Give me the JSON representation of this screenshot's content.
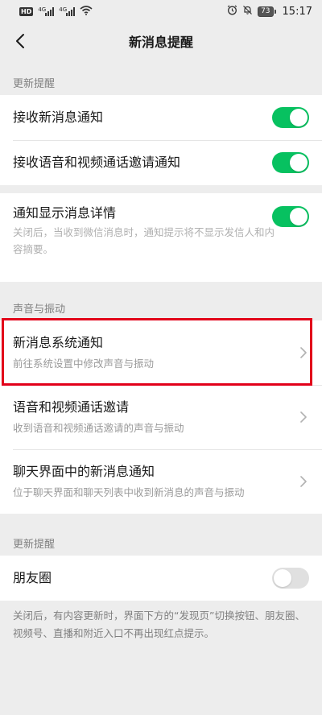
{
  "status_bar": {
    "hd_badge": "HD",
    "sim1_label": "4G",
    "sim2_label": "4G",
    "battery": "73",
    "time": "15:17"
  },
  "nav": {
    "title": "新消息提醒"
  },
  "sections": {
    "update_reminder_header": "更新提醒",
    "sound_vibration_header": "声音与振动",
    "update_reminder_header_2": "更新提醒"
  },
  "notifications": {
    "receive_new": {
      "label": "接收新消息通知",
      "enabled": true
    },
    "receive_call": {
      "label": "接收语音和视频通话邀请通知",
      "enabled": true
    },
    "show_details": {
      "label": "通知显示消息详情",
      "enabled": true,
      "description": "关闭后，当收到微信消息时，通知提示将不显示发信人和内容摘要。"
    }
  },
  "sound": {
    "system_notify": {
      "label": "新消息系统通知",
      "sub": "前往系统设置中修改声音与振动"
    },
    "call_invite": {
      "label": "语音和视频通话邀请",
      "sub": "收到语音和视频通话邀请的声音与振动"
    },
    "chat_notify": {
      "label": "聊天界面中的新消息通知",
      "sub": "位于聊天界面和聊天列表中收到新消息的声音与振动"
    }
  },
  "moments": {
    "label": "朋友圈",
    "enabled": false,
    "note": "关闭后，有内容更新时，界面下方的“发现页”切换按钮、朋友圈、视频号、直播和附近入口不再出现红点提示。"
  },
  "colors": {
    "accent_green": "#07c160",
    "highlight_red": "#e2001a",
    "background": "#ededed"
  }
}
